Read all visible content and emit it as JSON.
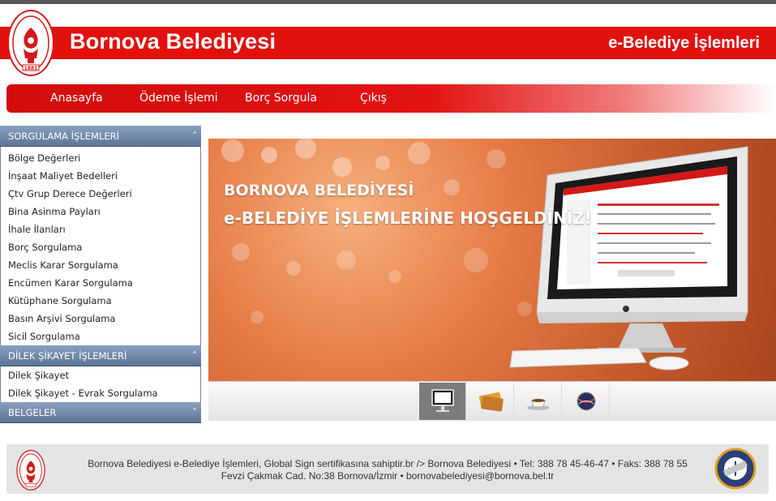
{
  "header": {
    "title": "Bornova Belediyesi",
    "subtitle": "e-Belediye İşlemleri",
    "brand_color": "#e2110f"
  },
  "nav": {
    "items": [
      "Anasayfa",
      "Ödeme İşlemi",
      "Borç Sorgula",
      "Çıkış"
    ]
  },
  "sidebar": {
    "sections": [
      {
        "title": "SORGULAMA İŞLEMLERİ",
        "icon": "chevron-up-icon",
        "items": [
          "Bölge Değerleri",
          "İnşaat Maliyet Bedelleri",
          "Çtv Grup Derece Değerleri",
          "Bina Asinma Payları",
          "İhale İlanları",
          "Borç Sorgulama",
          "Meclis Karar Sorgulama",
          "Encümen Karar Sorgulama",
          "Kütüphane Sorgulama",
          "Basın Arşivi Sorgulama",
          "Sicil Sorgulama"
        ]
      },
      {
        "title": "DİLEK ŞİKAYET İŞLEMLERİ",
        "icon": "chevron-up-icon",
        "items": [
          "Dilek Şikayet",
          "Dilek Şikayet - Evrak Sorgulama"
        ]
      },
      {
        "title": "BELGELER",
        "icon": "chevron-down-icon",
        "items": []
      }
    ]
  },
  "banner": {
    "line1": "BORNOVA BELEDİYESİ",
    "line2": "e-BELEDİYE İŞLEMLERİNE HOŞGELDİNİZ!",
    "screen_title": "Bornova Belediyesi"
  },
  "thumbnails": {
    "items": [
      "monitor-icon",
      "credit-cards-icon",
      "coffee-cup-icon",
      "globe-icon"
    ],
    "active_index": 0
  },
  "footer": {
    "line1": "Bornova Belediyesi e-Belediye İşlemleri, Global Sign sertifikasına sahiptir.br /> Bornova Belediyesi • Tel: 388 78 45-46-47 • Faks: 388 78 55",
    "line2": "Fevzi Çakmak Cad. No:38 Bornova/İzmir • bornovabelediyesi@bornova.bel.tr"
  },
  "logo": {
    "year": "1881",
    "arc_text": "BORNOVA BELEDİYESİ"
  }
}
